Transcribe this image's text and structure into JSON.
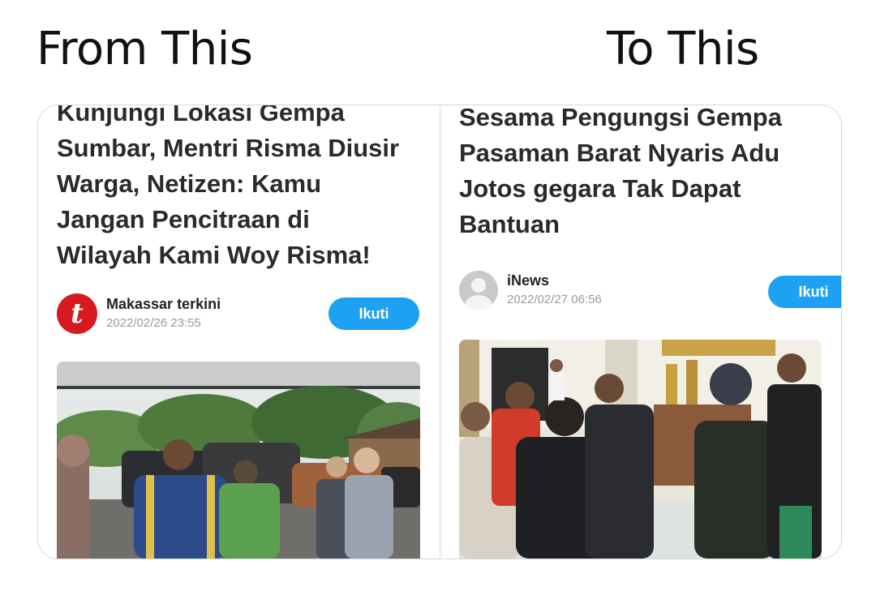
{
  "captions": {
    "left": "From This",
    "right": "To This"
  },
  "left_article": {
    "headline_lines": [
      "Kunjungi Lokasi Gempa",
      "Sumbar, Mentri Risma Diusir",
      "Warga, Netizen: Kamu",
      "Jangan Pencitraan di",
      "Wilayah Kami Woy Risma!"
    ],
    "source_name": "Makassar terkini",
    "date": "2022/02/26 23:55",
    "follow_label": "Ikuti",
    "logo_letter": "t",
    "logo_color": "#d71920",
    "photo_description_icon": "photo-crowd-outdoor"
  },
  "right_article": {
    "headline_lines": [
      "Sesama Pengungsi Gempa",
      "Pasaman Barat Nyaris Adu",
      "Jotos gegara Tak Dapat",
      "Bantuan"
    ],
    "source_name": "iNews",
    "date": "2022/02/27 06:56",
    "follow_label": "Ikuti",
    "avatar_icon": "default-avatar-icon",
    "photo_description_icon": "photo-crowd-indoor"
  },
  "colors": {
    "follow_button": "#1da1f2",
    "frame_border": "#cfd9de"
  }
}
